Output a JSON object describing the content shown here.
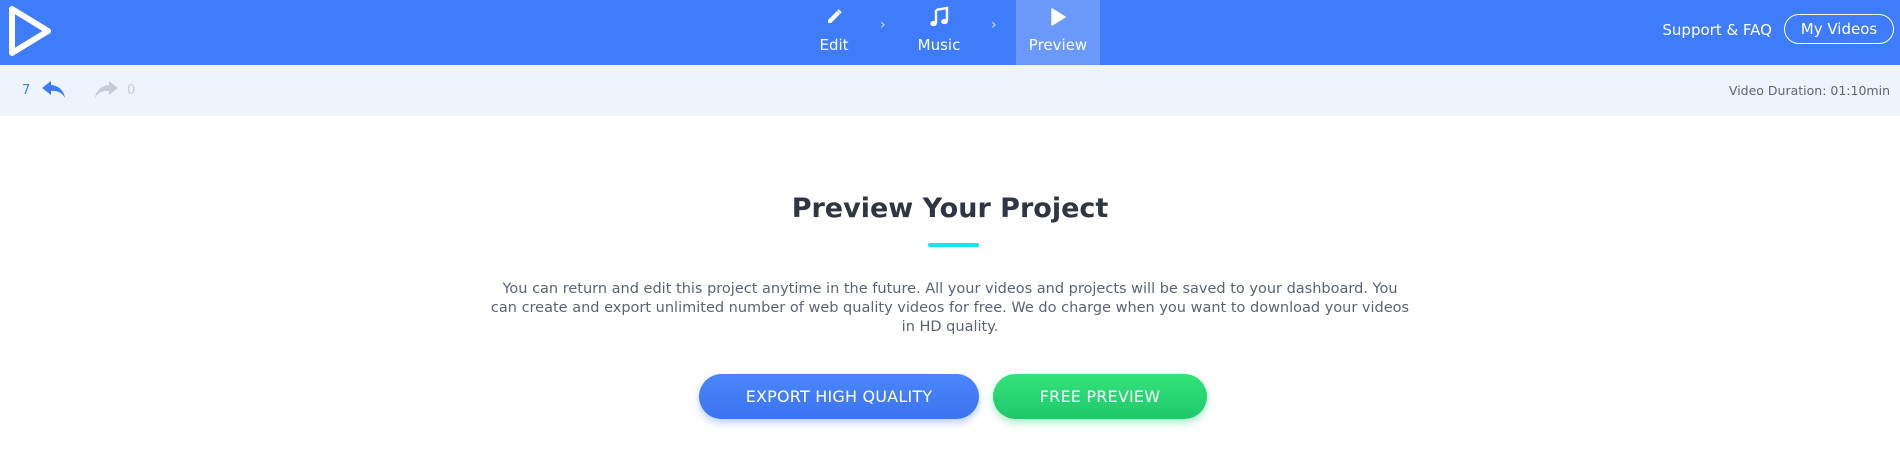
{
  "colors": {
    "topbar": "#3e7cf9",
    "active_step": "#6a98fb",
    "subbar": "#eef4fd",
    "accent_underline": "#15e6e6",
    "export_button": "#3e7cf9",
    "preview_button": "#22cc6d"
  },
  "header": {
    "logo_icon": "play-logo-icon",
    "steps": [
      {
        "label": "Edit",
        "icon": "pencil-icon"
      },
      {
        "label": "Music",
        "icon": "music-note-icon"
      },
      {
        "label": "Preview",
        "icon": "play-icon",
        "active": true
      }
    ],
    "support_label": "Support & FAQ",
    "my_videos_label": "My Videos"
  },
  "toolbar": {
    "undo_count": "7",
    "redo_count": "0",
    "undo_icon": "undo-icon",
    "redo_icon": "redo-icon",
    "duration_text": "Video Duration: 01:10min"
  },
  "main": {
    "title": "Preview Your Project",
    "description": "You can return and edit this project anytime in the future. All your videos and projects will be saved to your dashboard. You can create and export unlimited number of web quality videos for free. We do charge when you want to download your videos in HD quality.",
    "export_label": "EXPORT HIGH QUALITY",
    "preview_label": "FREE PREVIEW"
  }
}
